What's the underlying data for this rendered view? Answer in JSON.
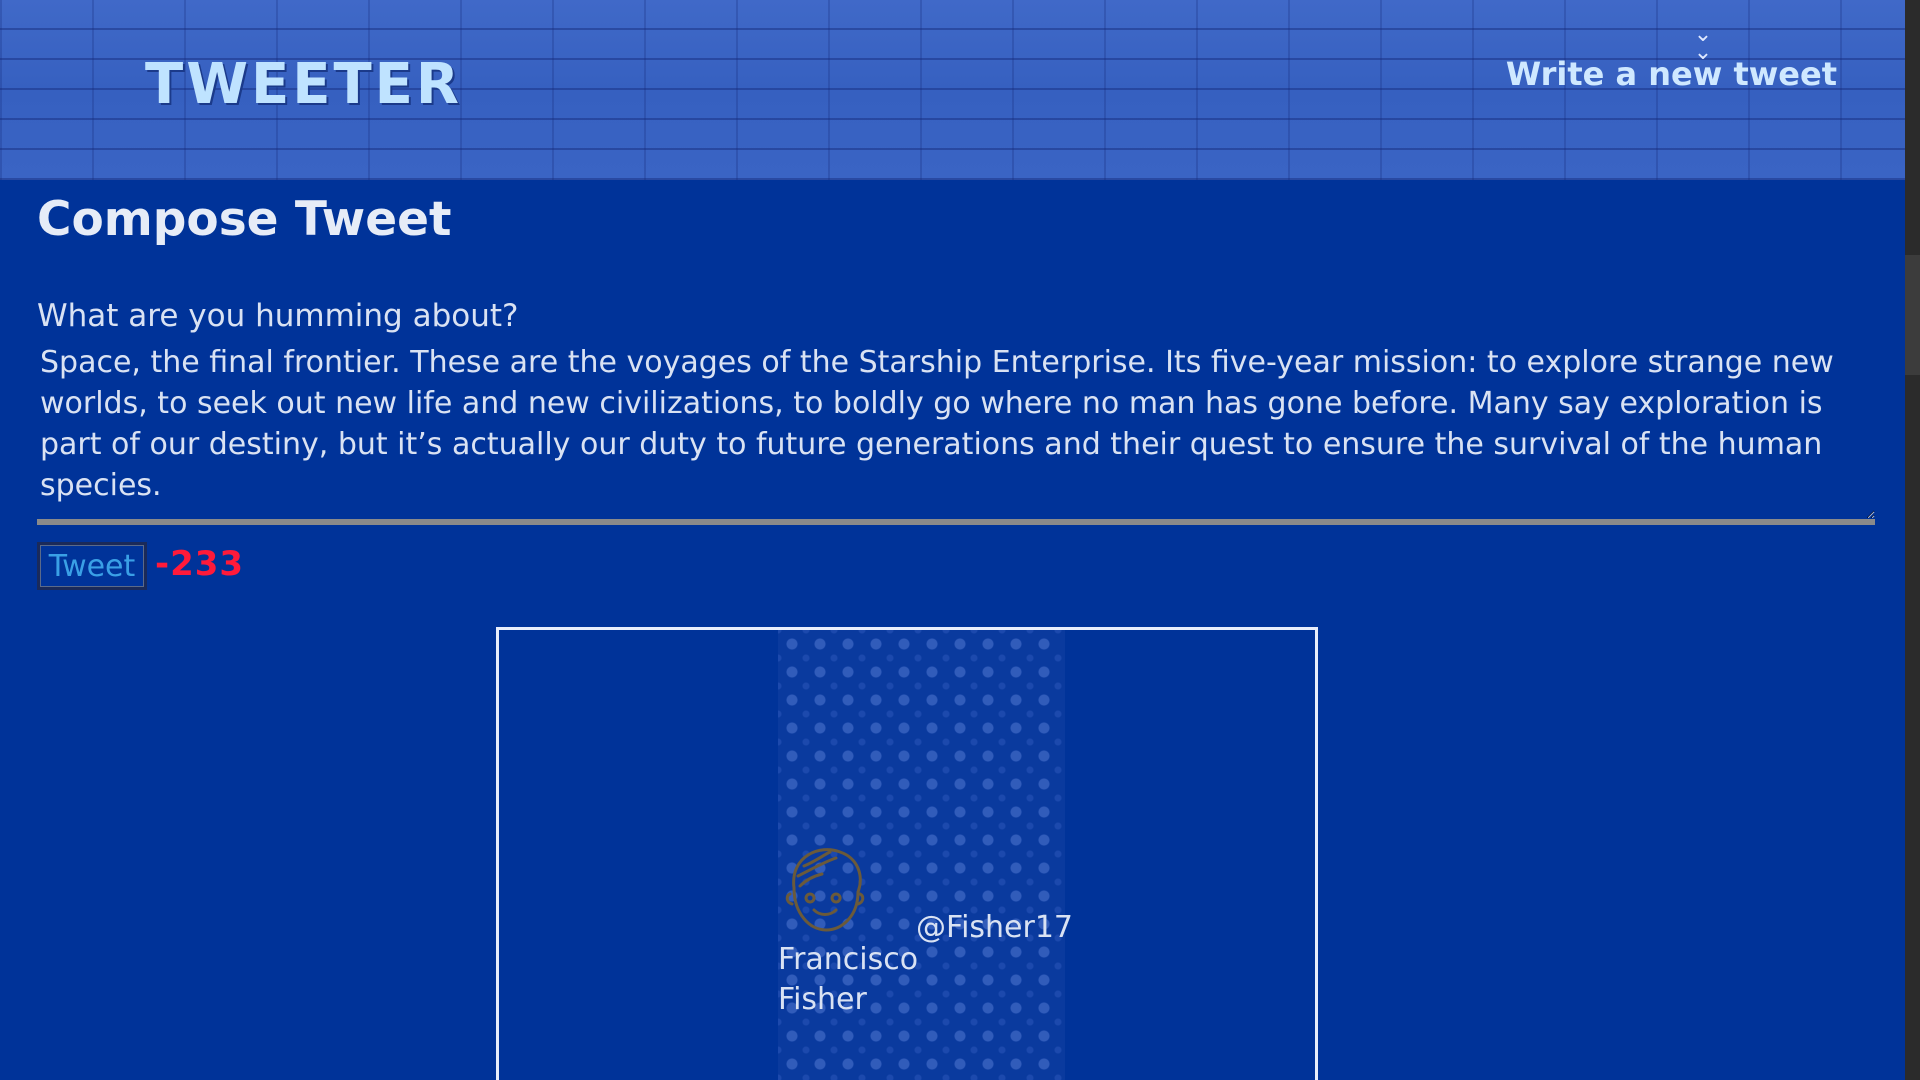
{
  "header": {
    "logo": "TWEETER",
    "write_link": "Write a new tweet",
    "chevron_icon": "double-chevron-down"
  },
  "compose": {
    "title": "Compose Tweet",
    "prompt": "What are you humming about?",
    "tweet_text": "Space, the final frontier. These are the voyages of the Starship Enterprise. Its five-year mission: to explore strange new worlds, to seek out new life and new civilizations, to boldly go where no man has gone before. Many say exploration is part of our destiny, but it’s actually our duty to future generations and their quest to ensure the survival of the human species.",
    "button_label": "Tweet",
    "counter": "-233",
    "counter_color": "#ff1a3a"
  },
  "tweet_card": {
    "name": "Francisco Fisher",
    "handle": "@Fisher17",
    "avatar_icon": "user-face-icon"
  },
  "colors": {
    "background": "#003399",
    "header": "#3a62c2",
    "text": "#d9e2f3"
  }
}
